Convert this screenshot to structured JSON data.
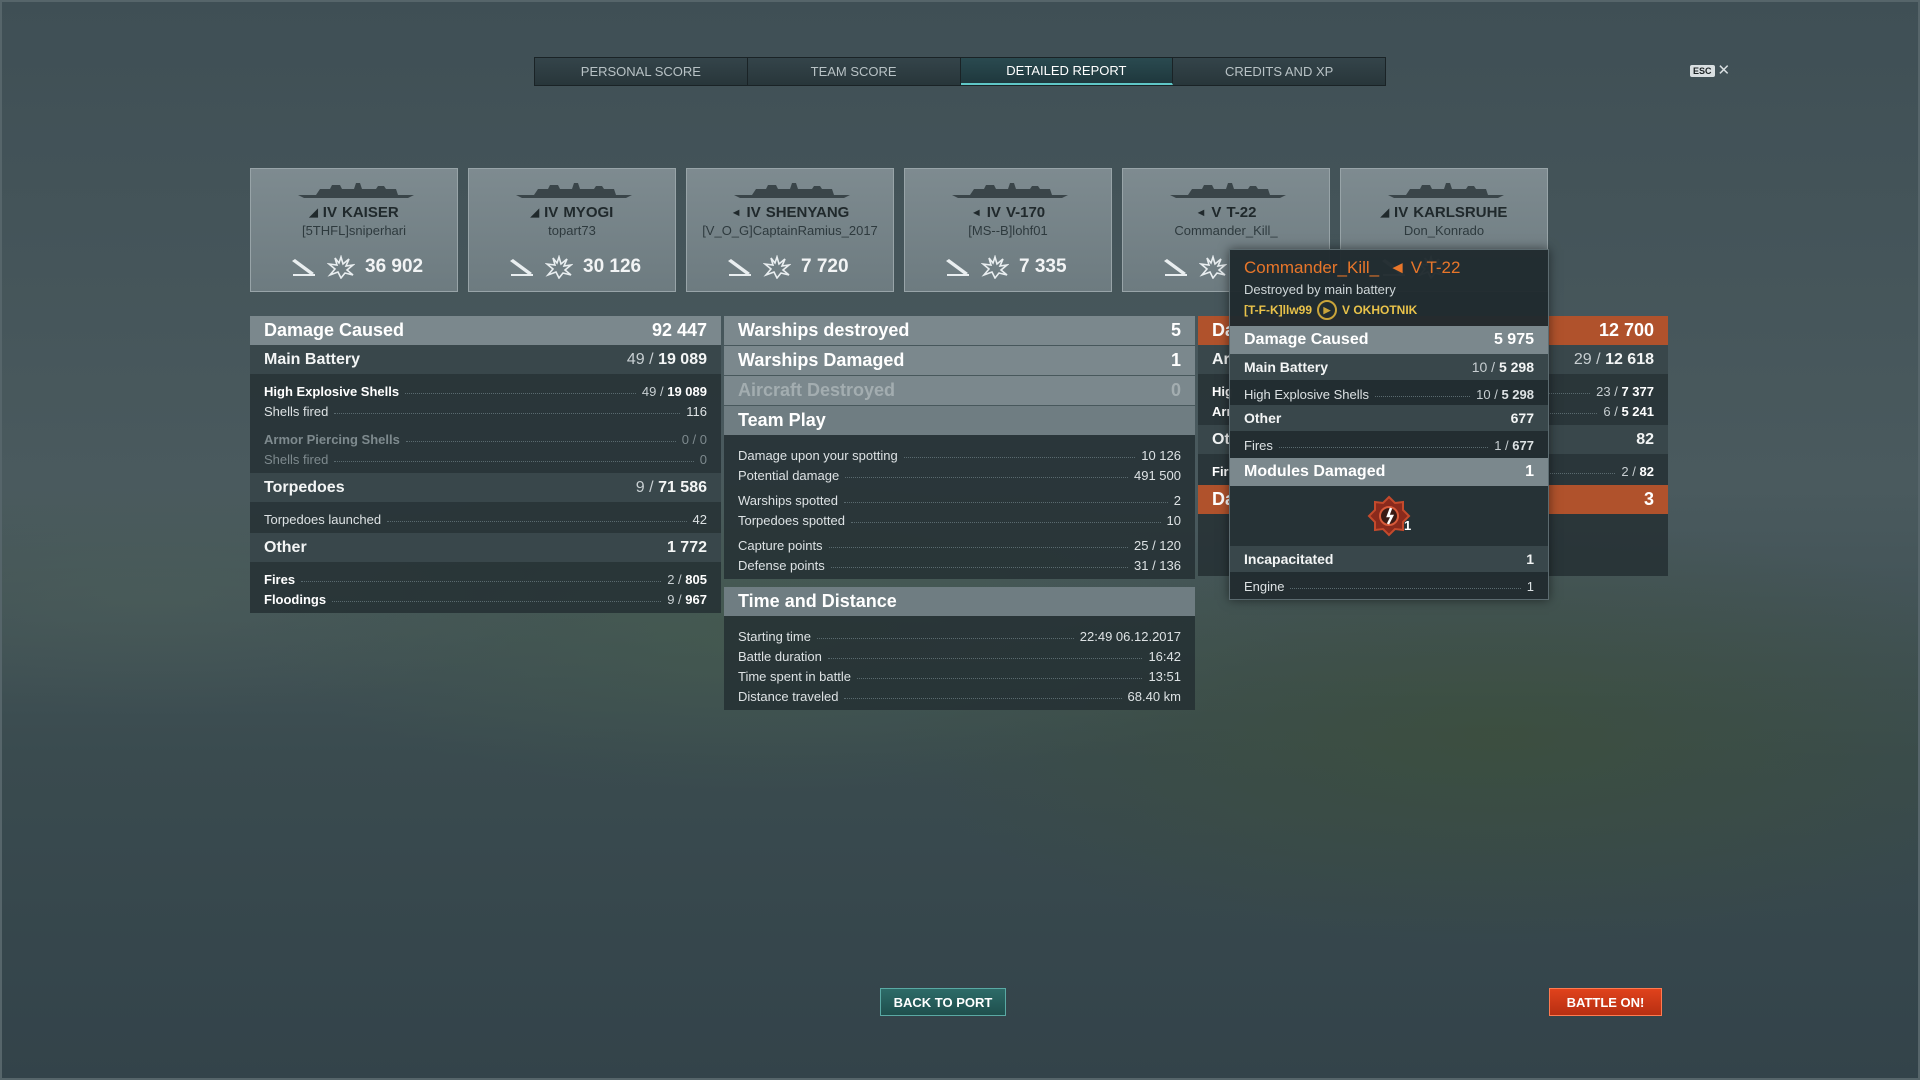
{
  "tabs": [
    {
      "label": "PERSONAL SCORE"
    },
    {
      "label": "TEAM SCORE"
    },
    {
      "label": "DETAILED REPORT"
    },
    {
      "label": "CREDITS AND XP"
    }
  ],
  "esc": {
    "key": "ESC",
    "close": "✕"
  },
  "ships": [
    {
      "tier": "IV",
      "name": "KAISER",
      "player": "[5THFL]sniperhari",
      "damage": "36 902"
    },
    {
      "tier": "IV",
      "name": "MYOGI",
      "player": "topart73",
      "damage": "30 126"
    },
    {
      "tier": "IV",
      "name": "SHENYANG",
      "player": "[V_O_G]CaptainRamius_2017",
      "damage": "7 720"
    },
    {
      "tier": "IV",
      "name": "V-170",
      "player": "[MS--B]lohf01",
      "damage": "7 335"
    },
    {
      "tier": "V",
      "name": "T-22",
      "player": "Commander_Kill_",
      "damage": ""
    },
    {
      "tier": "IV",
      "name": "KARLSRUHE",
      "player": "Don_Konrado",
      "damage": ""
    }
  ],
  "left": {
    "damage_caused": {
      "label": "Damage Caused",
      "value": "92 447"
    },
    "main_battery": {
      "label": "Main Battery",
      "hits": "49",
      "sep": "/",
      "dmg": "19 089"
    },
    "he": {
      "label": "High Explosive Shells",
      "hits": "49",
      "sep": "/",
      "dmg": "19 089"
    },
    "he_fired": {
      "label": "Shells fired",
      "value": "116"
    },
    "ap": {
      "label": "Armor Piercing Shells",
      "value": "0 / 0"
    },
    "ap_fired": {
      "label": "Shells fired",
      "value": "0"
    },
    "torpedoes": {
      "label": "Torpedoes",
      "hits": "9",
      "sep": "/",
      "dmg": "71 586"
    },
    "torp_launched": {
      "label": "Torpedoes launched",
      "value": "42"
    },
    "other": {
      "label": "Other",
      "value": "1 772"
    },
    "fires": {
      "label": "Fires",
      "hits": "2",
      "sep": "/",
      "dmg": "805"
    },
    "floodings": {
      "label": "Floodings",
      "hits": "9",
      "sep": "/",
      "dmg": "967"
    }
  },
  "mid": {
    "destroyed": {
      "label": "Warships destroyed",
      "value": "5"
    },
    "damaged": {
      "label": "Warships Damaged",
      "value": "1"
    },
    "aircraft": {
      "label": "Aircraft Destroyed",
      "value": "0"
    },
    "team_play": {
      "label": "Team Play"
    },
    "spotting": {
      "label": "Damage upon your spotting",
      "value": "10 126"
    },
    "potential": {
      "label": "Potential damage",
      "value": "491 500"
    },
    "ws_spotted": {
      "label": "Warships spotted",
      "value": "2"
    },
    "torp_spotted": {
      "label": "Torpedoes spotted",
      "value": "10"
    },
    "capture": {
      "label": "Capture points",
      "value": "25 / 120"
    },
    "defense": {
      "label": "Defense points",
      "value": "31 / 136"
    },
    "time_distance": {
      "label": "Time and Distance"
    },
    "start": {
      "label": "Starting time",
      "value": "22:49  06.12.2017"
    },
    "duration": {
      "label": "Battle duration",
      "value": "16:42"
    },
    "spent": {
      "label": "Time spent in battle",
      "value": "13:51"
    },
    "distance": {
      "label": "Distance traveled",
      "value": "68.40 km"
    }
  },
  "right": {
    "hdr1_prefix": "Da",
    "hdr1_value": "12 700",
    "row2_prefix": "Ar",
    "row2_hits": "29",
    "row2_sep": "/",
    "row2_dmg": "12 618",
    "row3_prefix": "Hig",
    "row3_hits": "23",
    "row3_sep": "/",
    "row3_dmg": "7 377",
    "row4_prefix": "Arn",
    "row4_hits": "6",
    "row4_sep": "/",
    "row4_dmg": "5 241",
    "row5_prefix": "Ot",
    "row5_value": "82",
    "row6_prefix": "Fir",
    "row6_hits": "2",
    "row6_sep": "/",
    "row6_dmg": "82",
    "row7_prefix": "Da",
    "row7_value": "3"
  },
  "tooltip": {
    "player": "Commander_Kill_",
    "ship": "V T-22",
    "cause": "Destroyed by main battery",
    "killer": "[T-F-K]llw99",
    "killer_ship": "V OKHOTNIK",
    "damage_caused": {
      "label": "Damage Caused",
      "value": "5 975"
    },
    "main_battery": {
      "label": "Main Battery",
      "hits": "10",
      "sep": "/",
      "dmg": "5 298"
    },
    "he": {
      "label": "High Explosive Shells",
      "hits": "10",
      "sep": "/",
      "dmg": "5 298"
    },
    "other": {
      "label": "Other",
      "value": "677"
    },
    "fires": {
      "label": "Fires",
      "hits": "1",
      "sep": "/",
      "dmg": "677"
    },
    "modules": {
      "label": "Modules Damaged",
      "value": "1"
    },
    "module_count": "1",
    "incapacitated": {
      "label": "Incapacitated",
      "value": "1"
    },
    "engine": {
      "label": "Engine",
      "value": "1"
    }
  },
  "buttons": {
    "back": "BACK TO PORT",
    "battle": "BATTLE ON!"
  },
  "colors": {
    "accent_teal": "#5fc7c7",
    "enemy_orange": "#e8762a",
    "battle_red": "#d23a18"
  }
}
